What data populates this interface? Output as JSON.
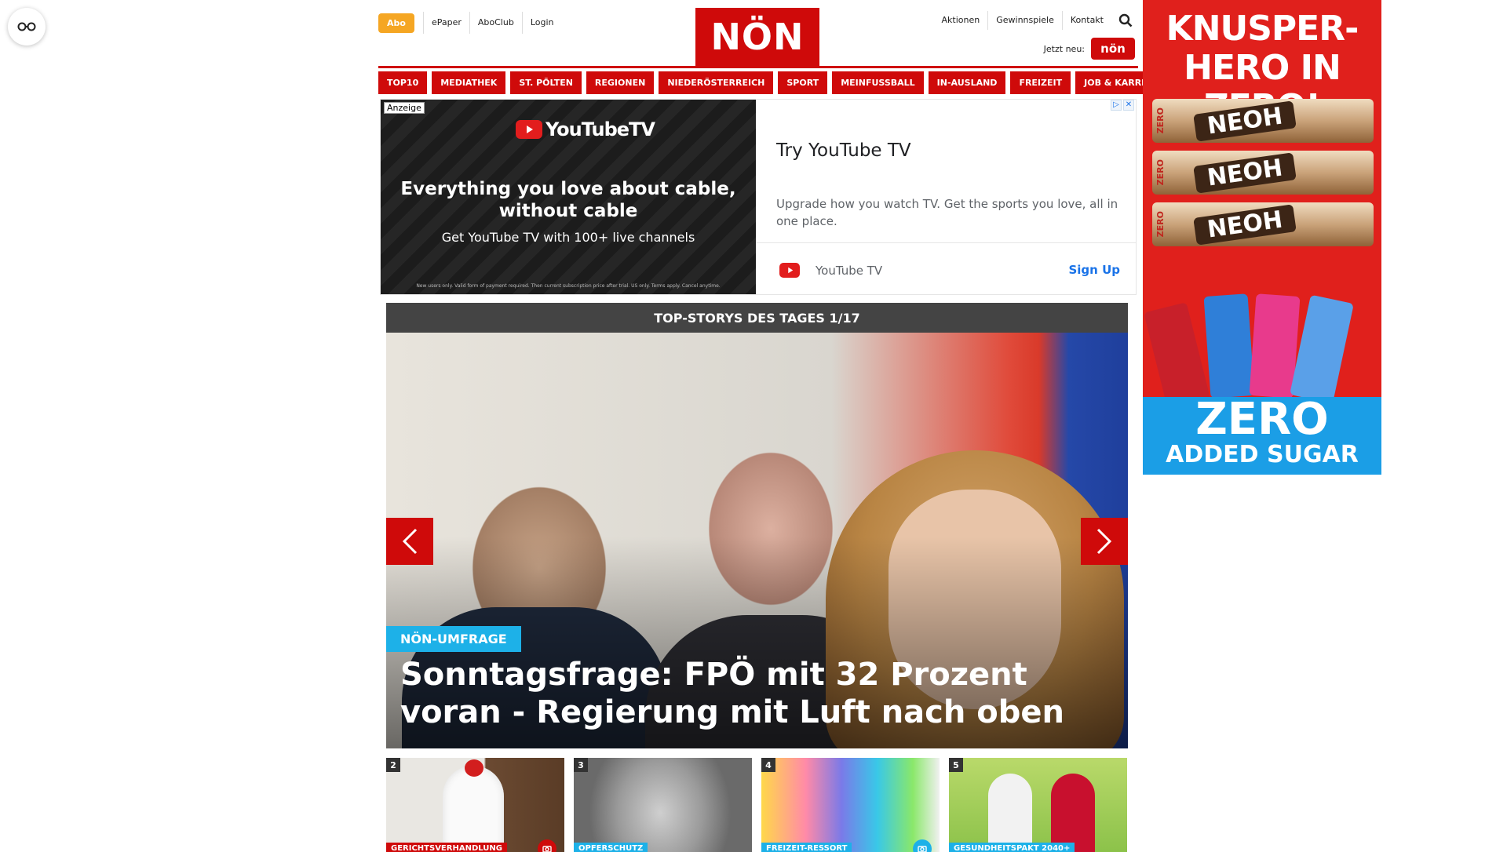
{
  "header": {
    "abo": "Abo",
    "left_links": [
      "ePaper",
      "AboClub",
      "Login"
    ],
    "logo": "NÖN",
    "right_links": [
      "Aktionen",
      "Gewinnspiele",
      "Kontakt"
    ],
    "jetzt_label": "Jetzt neu:",
    "jetzt_badge": "nön"
  },
  "nav": [
    "TOP10",
    "MEDIATHEK",
    "ST. PÖLTEN",
    "REGIONEN",
    "NIEDERÖSTERREICH",
    "SPORT",
    "MEINFUSSBALL",
    "IN-AUSLAND",
    "FREIZEIT",
    "JOB & KARRIERE"
  ],
  "ad": {
    "label": "Anzeige",
    "logo_text": "YouTubeTV",
    "headline": "Everything you love about cable, without cable",
    "sub": "Get YouTube TV with 100+ live channels",
    "fine": "New users only. Valid form of payment required. Then current subscription price after trial. US only. Terms apply. Cancel anytime.",
    "title": "Try YouTube TV",
    "description": "Upgrade how you watch TV. Get the sports you love, all in one place.",
    "brand": "YouTube TV",
    "cta": "Sign Up"
  },
  "stories": {
    "bar_title": "TOP-STORYS DES TAGES 1/17",
    "tag": "NÖN-UMFRAGE",
    "headline": "Sonntagsfrage: FPÖ mit 32 Prozent voran - Regierung mit Luft nach oben",
    "thumbs": [
      {
        "num": "2",
        "category": "GERICHTSVERHANDLUNG",
        "color": "#cf0a0a"
      },
      {
        "num": "3",
        "category": "OPFERSCHUTZ",
        "color": "#1db1e8"
      },
      {
        "num": "4",
        "category": "FREIZEIT-RESSORT",
        "color": "#1db1e8"
      },
      {
        "num": "5",
        "category": "GESUNDHEITSPAKT 2040+",
        "color": "#1db1e8"
      }
    ]
  },
  "side_ad": {
    "headline": "KNUSPER-HERO IN ZERO!",
    "bar_brand": "NEOH",
    "bar_label": "ZERO",
    "zero": "ZERO",
    "sugar": "ADDED SUGAR"
  }
}
